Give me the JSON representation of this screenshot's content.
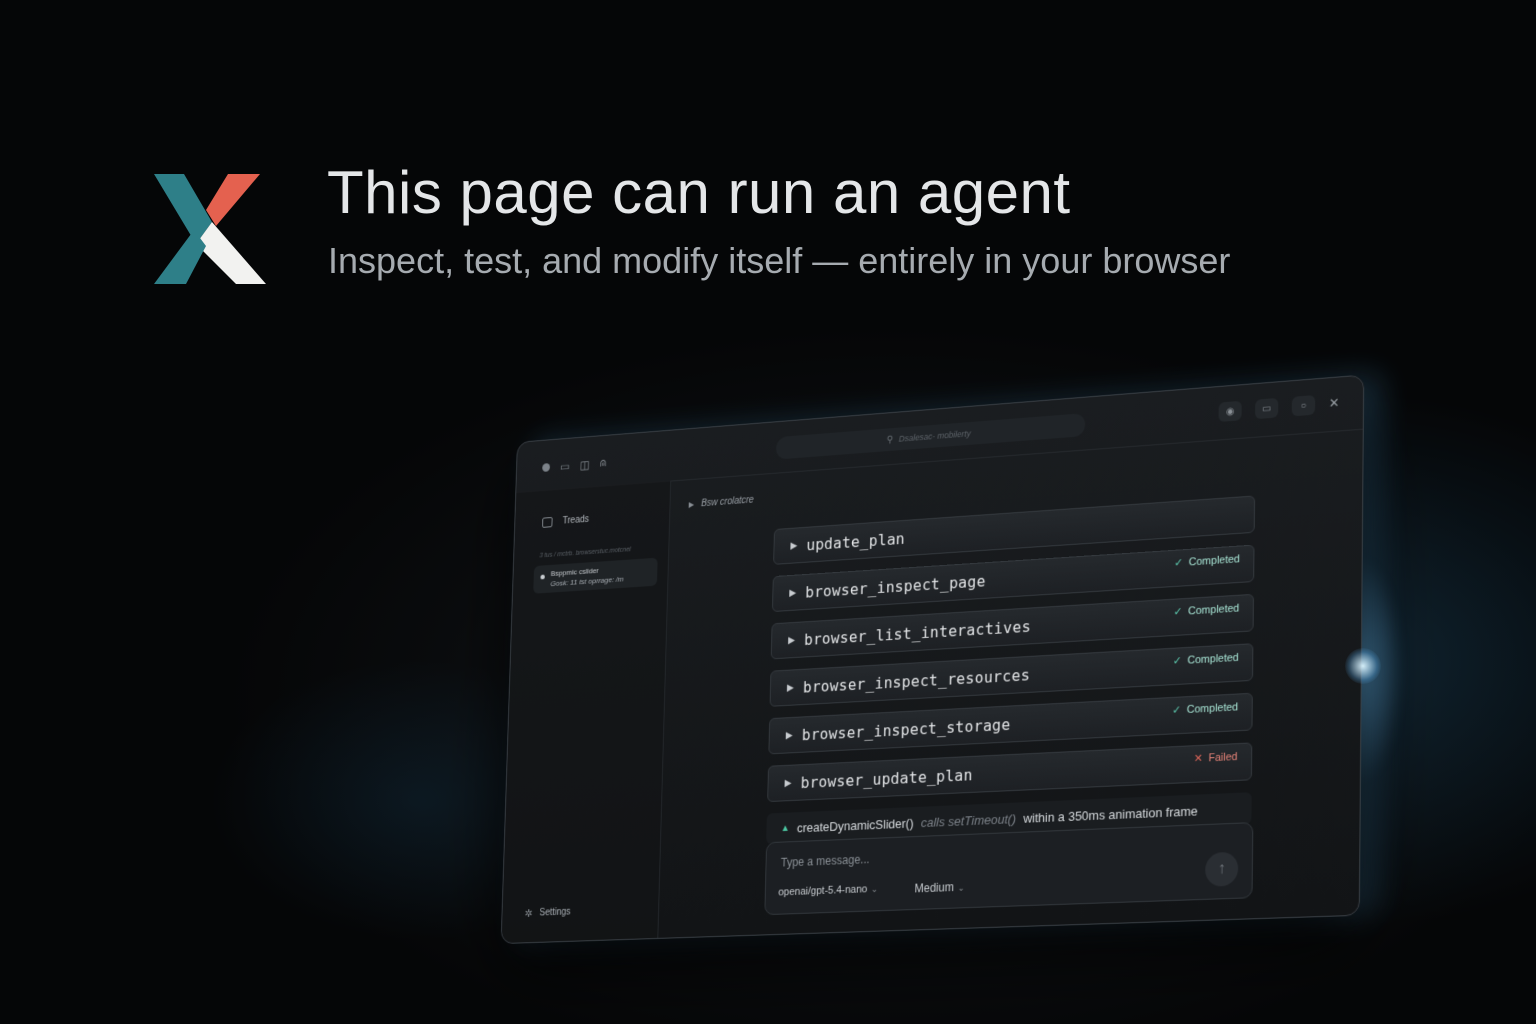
{
  "hero": {
    "title": "This page can run an agent",
    "subtitle": "Inspect, test, and modify itself — entirely in your browser"
  },
  "colors": {
    "logo_teal": "#2e7f88",
    "logo_coral": "#e4614f",
    "logo_white": "#f2f2f0",
    "success": "#5fd1b4",
    "failure": "#e0675a",
    "accent_glow": "#78c8ff"
  },
  "window": {
    "toolbar_left_icons": [
      "circle-icon",
      "chat-icon",
      "window-icon",
      "user-icon"
    ],
    "address_text": "Dsalesac- mobilerty",
    "toolbar_right_icons": [
      "eye-icon",
      "panel-icon",
      "search-icon",
      "close-icon"
    ]
  },
  "sidebar": {
    "threads_label": "Treads",
    "meta_text": "3 tus / mctrb. browserstuc.motcnel",
    "thread_item": {
      "line1": "Bsppmic cslider",
      "line2": "Gosk: 11 tst oprrage: /m"
    },
    "settings_label": "Settings"
  },
  "main": {
    "breadcrumb": "Bsw crolatcre",
    "tools": [
      {
        "name": "update_plan",
        "status": "",
        "status_icon": ""
      },
      {
        "name": "browser_inspect_page",
        "status": "Completed",
        "status_icon": "check-icon"
      },
      {
        "name": "browser_list_interactives",
        "status": "Completed",
        "status_icon": "check-icon"
      },
      {
        "name": "browser_inspect_resources",
        "status": "Completed",
        "status_icon": "check-icon"
      },
      {
        "name": "browser_inspect_storage",
        "status": "Completed",
        "status_icon": "check-icon"
      },
      {
        "name": "browser_update_plan",
        "status": "Failed",
        "status_icon": "x-icon"
      }
    ],
    "note": {
      "fn": "createDynamicSlider()",
      "mid": "calls setTimeout()",
      "rest": "within a 350ms animation frame"
    },
    "composer": {
      "placeholder": "Type a message...",
      "model": "openai/gpt-5.4-nano",
      "effort": "Medium"
    }
  }
}
